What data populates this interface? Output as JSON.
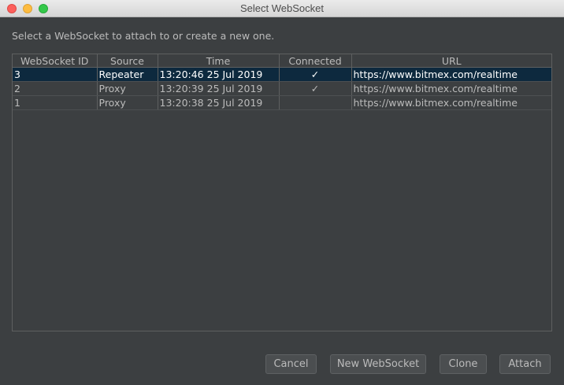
{
  "window": {
    "title": "Select WebSocket"
  },
  "instruction": "Select a WebSocket to attach to or create a new one.",
  "table": {
    "columns": [
      "WebSocket ID",
      "Source",
      "Time",
      "Connected",
      "URL"
    ],
    "rows": [
      {
        "id": "3",
        "source": "Repeater",
        "time": "13:20:46 25 Jul 2019",
        "connected": "✓",
        "url": "https://www.bitmex.com/realtime",
        "selected": true
      },
      {
        "id": "2",
        "source": "Proxy",
        "time": "13:20:39 25 Jul 2019",
        "connected": "✓",
        "url": "https://www.bitmex.com/realtime",
        "selected": false
      },
      {
        "id": "1",
        "source": "Proxy",
        "time": "13:20:38 25 Jul 2019",
        "connected": "",
        "url": "https://www.bitmex.com/realtime",
        "selected": false
      }
    ]
  },
  "buttons": {
    "cancel": "Cancel",
    "new_websocket": "New WebSocket",
    "clone": "Clone",
    "attach": "Attach"
  },
  "colors": {
    "background": "#3c3f41",
    "selection": "#0d293e",
    "text": "#bbbbbb"
  }
}
